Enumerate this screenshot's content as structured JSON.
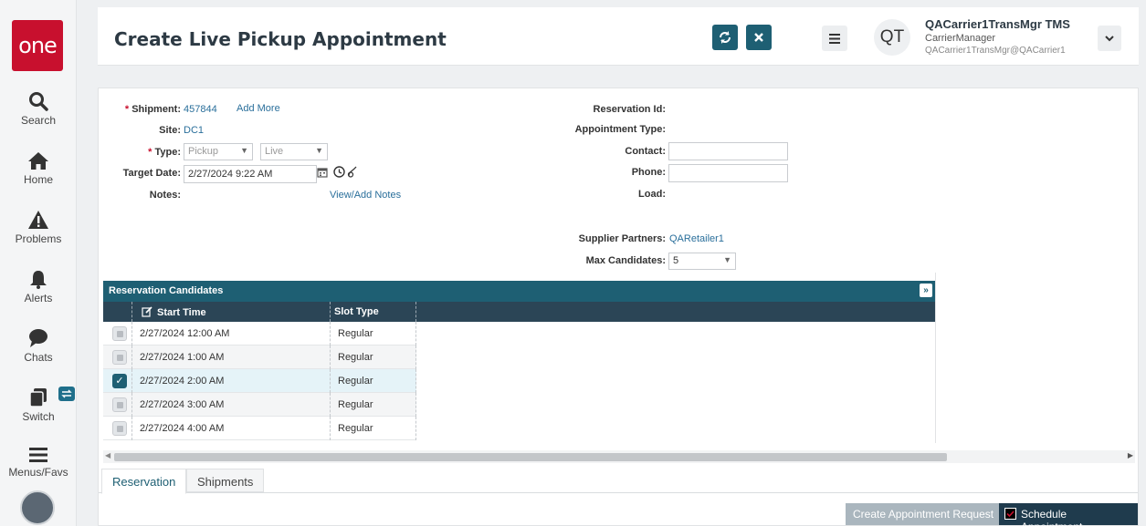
{
  "brand": {
    "logo_text": "one",
    "accent": "#1e5f73",
    "logo_color": "#c8102e"
  },
  "nav": {
    "search": "Search",
    "home": "Home",
    "problems": "Problems",
    "alerts": "Alerts",
    "chats": "Chats",
    "switch": "Switch",
    "menus": "Menus/Favs"
  },
  "header": {
    "title": "Create Live Pickup Appointment",
    "refresh_icon": "refresh-icon",
    "close_icon": "close-icon",
    "user": {
      "initials": "QT",
      "name": "QACarrier1TransMgr TMS",
      "role": "CarrierManager",
      "email": "QACarrier1TransMgr@QACarrier1"
    }
  },
  "form": {
    "shipment_label": "Shipment:",
    "shipment_value": "457844",
    "add_more": "Add More",
    "site_label": "Site:",
    "site_value": "DC1",
    "type_label": "Type:",
    "type_value": "Pickup",
    "mode_value": "Live",
    "target_date_label": "Target Date:",
    "target_date_value": "2/27/2024 9:22 AM",
    "notes_label": "Notes:",
    "view_add_notes": "View/Add Notes",
    "reservation_id_label": "Reservation Id:",
    "appointment_type_label": "Appointment Type:",
    "contact_label": "Contact:",
    "phone_label": "Phone:",
    "load_label": "Load:",
    "supplier_partners_label": "Supplier Partners:",
    "supplier_partners_value": "QARetailer1",
    "max_candidates_label": "Max Candidates:",
    "max_candidates_value": "5"
  },
  "grid": {
    "title": "Reservation Candidates",
    "columns": [
      "Start Time",
      "Slot Type"
    ],
    "rows": [
      {
        "start": "2/27/2024 12:00 AM",
        "slot": "Regular",
        "checked": false
      },
      {
        "start": "2/27/2024 1:00 AM",
        "slot": "Regular",
        "checked": false
      },
      {
        "start": "2/27/2024 2:00 AM",
        "slot": "Regular",
        "checked": true
      },
      {
        "start": "2/27/2024 3:00 AM",
        "slot": "Regular",
        "checked": false
      },
      {
        "start": "2/27/2024 4:00 AM",
        "slot": "Regular",
        "checked": false
      }
    ]
  },
  "tabs": [
    "Reservation",
    "Shipments"
  ],
  "footer": {
    "create_request": "Create Appointment Request",
    "schedule": "Schedule Appointment"
  }
}
